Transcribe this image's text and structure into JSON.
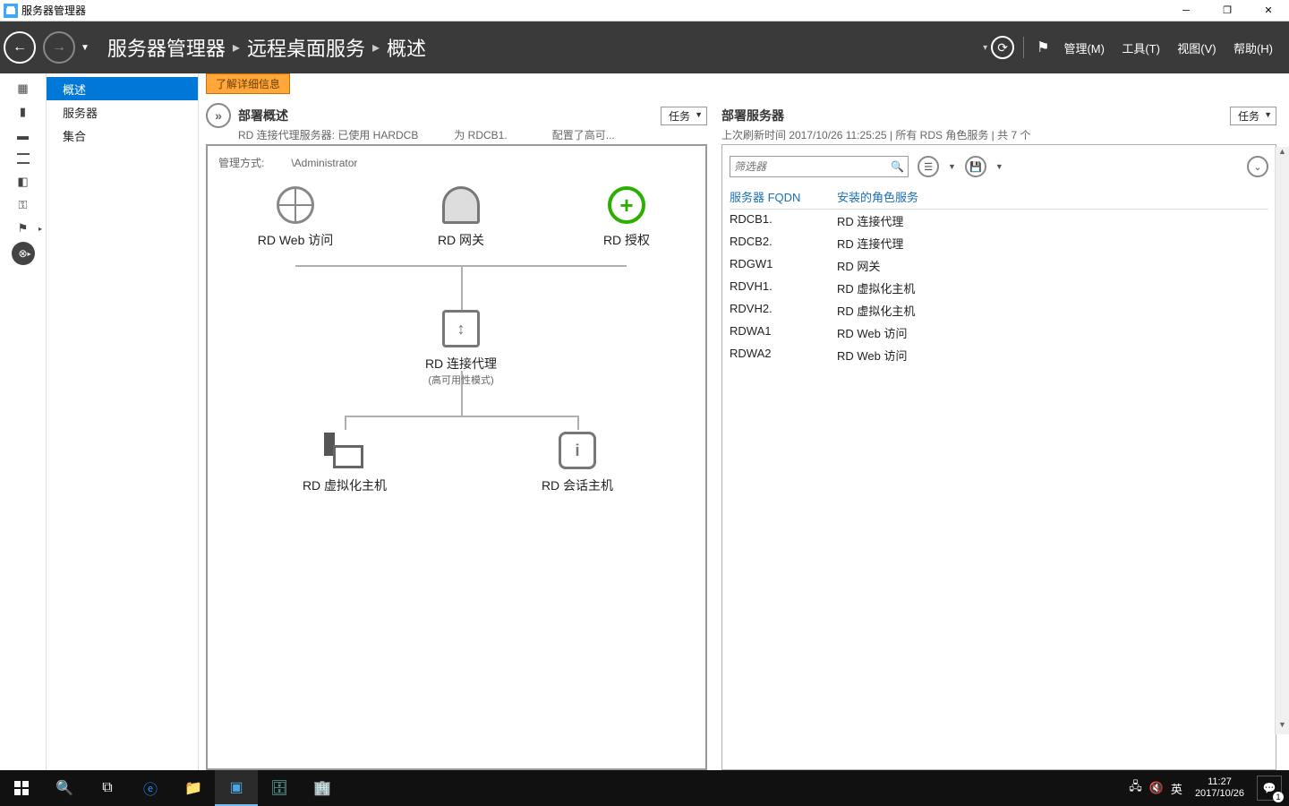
{
  "titlebar": {
    "title": "服务器管理器"
  },
  "topnav": {
    "crumb1": "服务器管理器",
    "crumb2": "远程桌面服务",
    "crumb3": "概述",
    "menu": {
      "manage": "管理(M)",
      "tools": "工具(T)",
      "view": "视图(V)",
      "help": "帮助(H)"
    }
  },
  "sidenav": {
    "items": [
      "概述",
      "服务器",
      "集合"
    ]
  },
  "notice": "了解详细信息",
  "panel_left": {
    "title": "部署概述",
    "sub_prefix": "RD 连接代理服务器: 已使用 HARDCB",
    "sub_mid": "为 RDCB1.",
    "sub_suffix": "配置了高可...",
    "tasks": "任务",
    "mgmt_label": "管理方式:",
    "mgmt_value": "\\Administrator",
    "nodes": {
      "web": "RD Web 访问",
      "gateway": "RD 网关",
      "license": "RD 授权",
      "broker": "RD 连接代理",
      "broker_sub": "(高可用性模式)",
      "vhost": "RD 虚拟化主机",
      "session": "RD 会话主机"
    }
  },
  "panel_right": {
    "title": "部署服务器",
    "sub": "上次刷新时间 2017/10/26 11:25:25 | 所有 RDS 角色服务  | 共 7 个",
    "tasks": "任务",
    "filter_placeholder": "筛选器",
    "col1": "服务器 FQDN",
    "col2": "安装的角色服务",
    "rows": [
      {
        "fqdn": "RDCB1.",
        "role": "RD 连接代理"
      },
      {
        "fqdn": "RDCB2.",
        "role": "RD 连接代理"
      },
      {
        "fqdn": "RDGW1",
        "role": "RD 网关"
      },
      {
        "fqdn": "RDVH1.",
        "role": "RD 虚拟化主机"
      },
      {
        "fqdn": "RDVH2.",
        "role": "RD 虚拟化主机"
      },
      {
        "fqdn": "RDWA1",
        "role": "RD Web 访问"
      },
      {
        "fqdn": "RDWA2",
        "role": "RD Web 访问"
      }
    ]
  },
  "taskbar": {
    "ime": "英",
    "time": "11:27",
    "date": "2017/10/26",
    "notif_count": "1"
  }
}
